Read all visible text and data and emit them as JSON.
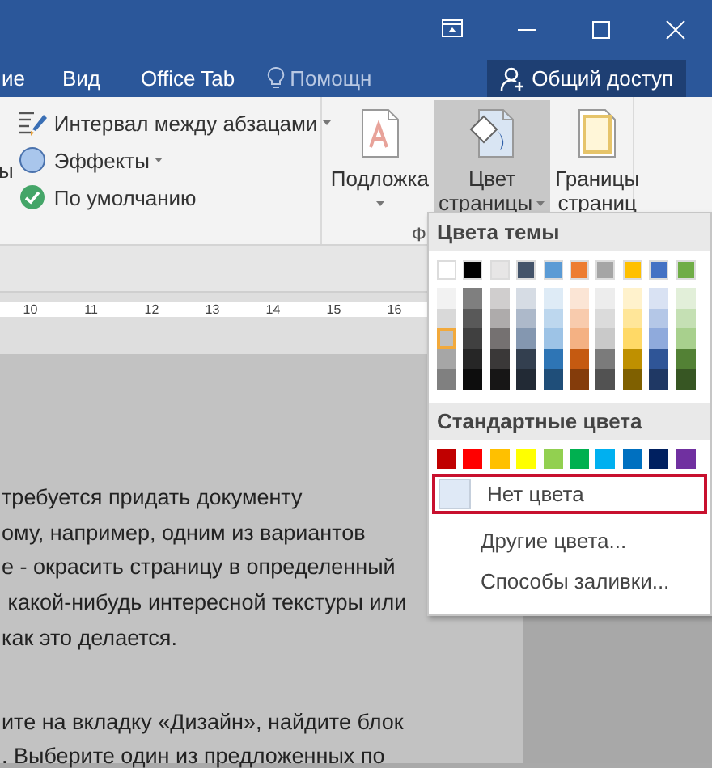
{
  "window": {
    "buttons": [
      {
        "kind": "ribbon-display"
      },
      {
        "kind": "minimize"
      },
      {
        "kind": "maximize"
      },
      {
        "kind": "close"
      }
    ]
  },
  "tabs": [
    {
      "label": "ие",
      "selected": false
    },
    {
      "label": "Вид",
      "selected": false
    },
    {
      "label": "Office Tab",
      "selected": false
    }
  ],
  "help": {
    "label": "Помощн"
  },
  "share_button": {
    "label": "Общий доступ"
  },
  "ribbon": {
    "cut_label": "ы",
    "paragraph_items": [
      {
        "label": "Интервал между абзацами",
        "kind": "spacing",
        "dropdown": true
      },
      {
        "label": "Эффекты",
        "kind": "effects",
        "dropdown": true
      },
      {
        "label": "По умолчанию",
        "kind": "default",
        "dropdown": false
      }
    ],
    "page_buttons": [
      {
        "lines": [
          "Подложка"
        ],
        "kind": "watermark",
        "selected": false,
        "dropdown": true
      },
      {
        "lines": [
          "Цвет",
          "страницы"
        ],
        "kind": "page-color",
        "selected": true,
        "dropdown": true
      },
      {
        "lines": [
          "Границы",
          "страниц"
        ],
        "kind": "borders",
        "selected": false,
        "dropdown": false
      }
    ],
    "group_label": "Ф"
  },
  "ruler": {
    "marks": [
      "10",
      "11",
      "12",
      "13",
      "14",
      "15",
      "16"
    ]
  },
  "document": {
    "paragraphs": [
      [
        "требуется придать документу",
        "ому, например, одним из вариантов",
        "е - окрасить страницу в определенный",
        " какой-нибудь интересной текстуры или",
        "как это делается."
      ],
      [
        "ите на вкладку «Дизайн», найдите блок",
        ". Выберите один из предложенных по"
      ]
    ]
  },
  "color_menu": {
    "theme_header": "Цвета темы",
    "theme_colors": [
      {
        "color": "#ffffff",
        "selected": false,
        "shades": [
          {
            "color": "#f2f2f2",
            "selected": false
          },
          {
            "color": "#d9d9d9",
            "selected": false
          },
          {
            "color": "#bfbfbf",
            "selected": true
          },
          {
            "color": "#a6a6a6",
            "selected": false
          },
          {
            "color": "#808080",
            "selected": false
          }
        ]
      },
      {
        "color": "#000000",
        "selected": false,
        "shades": [
          {
            "color": "#7f7f7f",
            "selected": false
          },
          {
            "color": "#595959",
            "selected": false
          },
          {
            "color": "#404040",
            "selected": false
          },
          {
            "color": "#262626",
            "selected": false
          },
          {
            "color": "#0d0d0d",
            "selected": false
          }
        ]
      },
      {
        "color": "#e7e6e6",
        "selected": false,
        "shades": [
          {
            "color": "#d0cece",
            "selected": false
          },
          {
            "color": "#aeabab",
            "selected": false
          },
          {
            "color": "#757171",
            "selected": false
          },
          {
            "color": "#3a3838",
            "selected": false
          },
          {
            "color": "#171616",
            "selected": false
          }
        ]
      },
      {
        "color": "#44546a",
        "selected": false,
        "shades": [
          {
            "color": "#d6dce4",
            "selected": false
          },
          {
            "color": "#adb9ca",
            "selected": false
          },
          {
            "color": "#8497b0",
            "selected": false
          },
          {
            "color": "#333f4f",
            "selected": false
          },
          {
            "color": "#222a35",
            "selected": false
          }
        ]
      },
      {
        "color": "#5b9bd5",
        "selected": false,
        "shades": [
          {
            "color": "#deebf6",
            "selected": false
          },
          {
            "color": "#bdd7ee",
            "selected": false
          },
          {
            "color": "#9dc3e6",
            "selected": false
          },
          {
            "color": "#2e75b5",
            "selected": false
          },
          {
            "color": "#1f4e79",
            "selected": false
          }
        ]
      },
      {
        "color": "#ed7d31",
        "selected": false,
        "shades": [
          {
            "color": "#fbe5d5",
            "selected": false
          },
          {
            "color": "#f8cbad",
            "selected": false
          },
          {
            "color": "#f4b183",
            "selected": false
          },
          {
            "color": "#c55a11",
            "selected": false
          },
          {
            "color": "#843c0b",
            "selected": false
          }
        ]
      },
      {
        "color": "#a5a5a5",
        "selected": false,
        "shades": [
          {
            "color": "#ededed",
            "selected": false
          },
          {
            "color": "#dbdbdb",
            "selected": false
          },
          {
            "color": "#c9c9c9",
            "selected": false
          },
          {
            "color": "#7b7b7b",
            "selected": false
          },
          {
            "color": "#525252",
            "selected": false
          }
        ]
      },
      {
        "color": "#ffc000",
        "selected": false,
        "shades": [
          {
            "color": "#fff2cc",
            "selected": false
          },
          {
            "color": "#ffe699",
            "selected": false
          },
          {
            "color": "#ffd966",
            "selected": false
          },
          {
            "color": "#bf9000",
            "selected": false
          },
          {
            "color": "#7f6000",
            "selected": false
          }
        ]
      },
      {
        "color": "#4472c4",
        "selected": false,
        "shades": [
          {
            "color": "#d9e2f3",
            "selected": false
          },
          {
            "color": "#b4c7e7",
            "selected": false
          },
          {
            "color": "#8faadc",
            "selected": false
          },
          {
            "color": "#2f5597",
            "selected": false
          },
          {
            "color": "#1f3864",
            "selected": false
          }
        ]
      },
      {
        "color": "#70ad47",
        "selected": false,
        "shades": [
          {
            "color": "#e2efd9",
            "selected": false
          },
          {
            "color": "#c5e0b4",
            "selected": false
          },
          {
            "color": "#a8d08d",
            "selected": false
          },
          {
            "color": "#538135",
            "selected": false
          },
          {
            "color": "#375623",
            "selected": false
          }
        ]
      }
    ],
    "standard_header": "Стандартные цвета",
    "standard_colors": [
      {
        "color": "#c00000",
        "selected": false
      },
      {
        "color": "#ff0000",
        "selected": false
      },
      {
        "color": "#ffc000",
        "selected": false
      },
      {
        "color": "#ffff00",
        "selected": false
      },
      {
        "color": "#92d050",
        "selected": false
      },
      {
        "color": "#00b050",
        "selected": false
      },
      {
        "color": "#00b0f0",
        "selected": false
      },
      {
        "color": "#0070c0",
        "selected": false
      },
      {
        "color": "#002060",
        "selected": false
      },
      {
        "color": "#7030a0",
        "selected": false
      }
    ],
    "items": [
      {
        "label": "Нет цвета",
        "kind": "no-color",
        "highlighted": true
      },
      {
        "label": "Другие цвета...",
        "kind": "more",
        "highlighted": false
      },
      {
        "label": "Способы заливки...",
        "kind": "fill",
        "highlighted": false
      }
    ]
  }
}
